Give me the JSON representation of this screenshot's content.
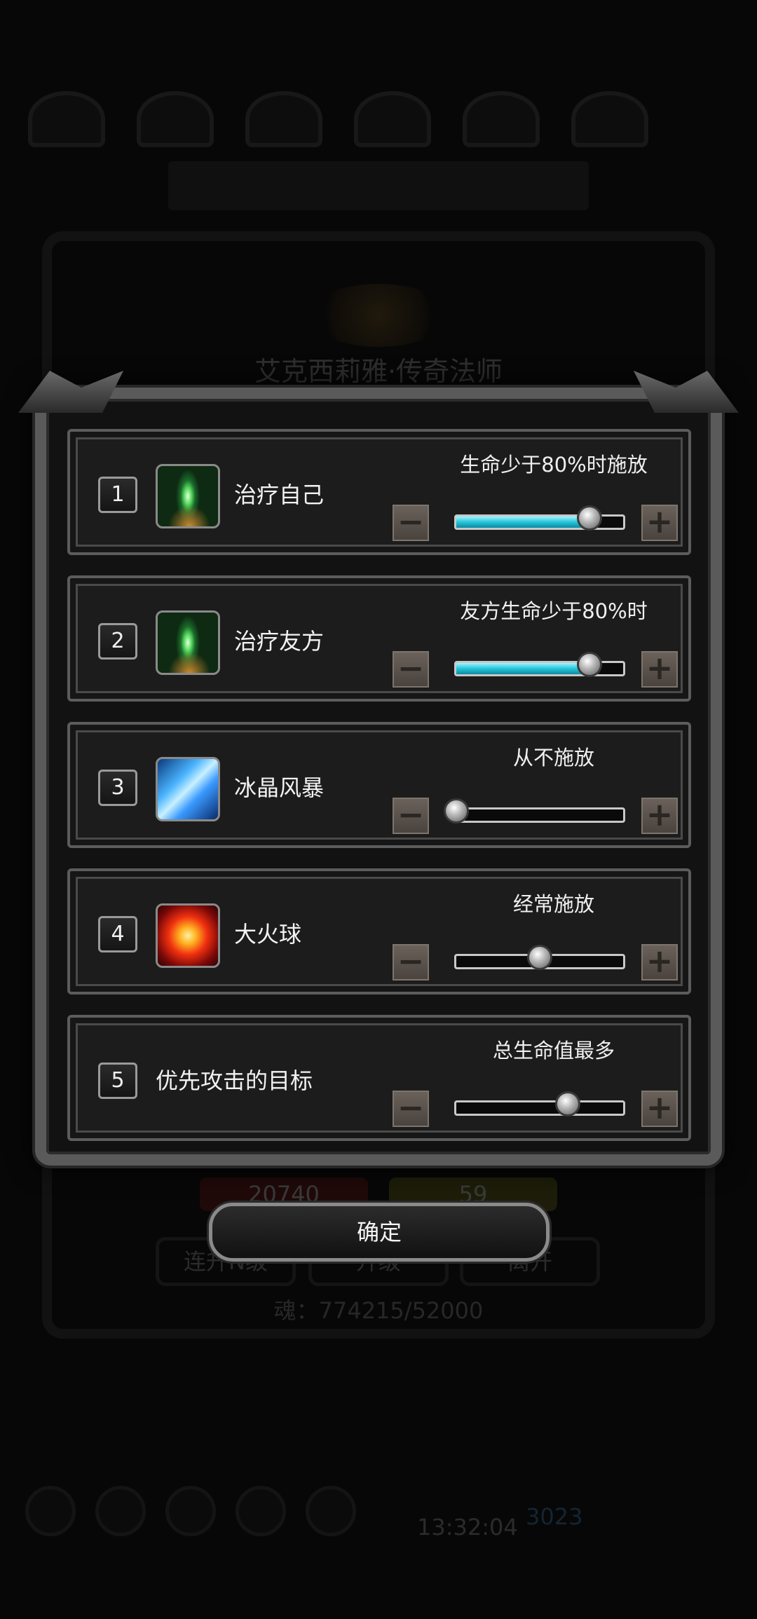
{
  "background": {
    "hero_name": "艾克西莉雅·传奇法师",
    "health": "20740",
    "energy": "59",
    "buttons": [
      "连升N级",
      "升级",
      "离开"
    ],
    "soul": "魂：774215/52000",
    "clock": "13:32:04",
    "gems": "3023"
  },
  "skills": [
    {
      "number": "1",
      "name": "治疗自己",
      "icon": "heal-icon",
      "condition": "生命少于80%时施放",
      "level": 0.8
    },
    {
      "number": "2",
      "name": "治疗友方",
      "icon": "heal-icon",
      "condition": "友方生命少于80%时",
      "level": 0.8
    },
    {
      "number": "3",
      "name": "冰晶风暴",
      "icon": "ice-storm-icon",
      "condition": "从不施放",
      "level": 0.0
    },
    {
      "number": "4",
      "name": "大火球",
      "icon": "fireball-icon",
      "condition": "经常施放",
      "level": 0.5
    },
    {
      "number": "5",
      "name": "优先攻击的目标",
      "icon": null,
      "condition": "总生命值最多",
      "level": 0.67
    }
  ],
  "controls": {
    "minus": "−",
    "plus": "+"
  },
  "confirm_label": "确定",
  "colors": {
    "slider_fill": "#26c4d8",
    "modal_border": "#5a5a5a"
  }
}
